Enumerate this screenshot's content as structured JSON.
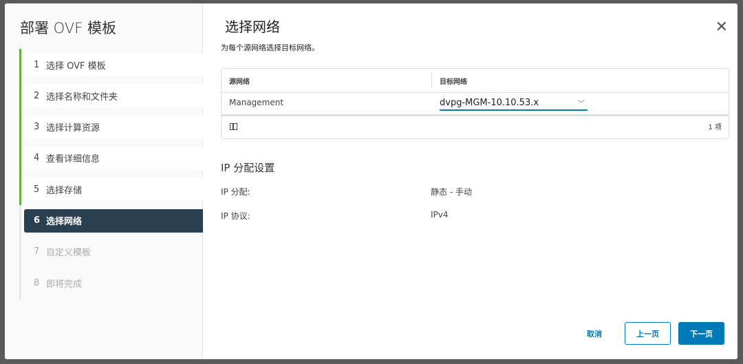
{
  "wizard": {
    "title": "部署 OVF 模板",
    "steps": [
      {
        "num": "1",
        "label": "选择 OVF 模板",
        "state": "complete"
      },
      {
        "num": "2",
        "label": "选择名称和文件夹",
        "state": "complete"
      },
      {
        "num": "3",
        "label": "选择计算资源",
        "state": "complete"
      },
      {
        "num": "4",
        "label": "查看详细信息",
        "state": "complete"
      },
      {
        "num": "5",
        "label": "选择存储",
        "state": "complete"
      },
      {
        "num": "6",
        "label": "选择网络",
        "state": "active"
      },
      {
        "num": "7",
        "label": "自定义模板",
        "state": "todo"
      },
      {
        "num": "8",
        "label": "即将完成",
        "state": "todo"
      }
    ]
  },
  "page": {
    "title": "选择网络",
    "close_icon": "close-icon",
    "description": "为每个源网络选择目标网络。"
  },
  "grid": {
    "headers": [
      "源网络",
      "目标网络"
    ],
    "rows": [
      {
        "source": "Management",
        "target": "dvpg-MGM-10.10.53.x"
      }
    ],
    "footer_count": "1 项",
    "columns_icon": "column-toggle-icon"
  },
  "ip": {
    "title": "IP 分配设置",
    "items": [
      {
        "label": "IP 分配:",
        "value": "静态 - 手动"
      },
      {
        "label": "IP 协议:",
        "value": "IPv4"
      }
    ]
  },
  "buttons": {
    "cancel": "取消",
    "back": "上一页",
    "next": "下一页"
  },
  "colors": {
    "accent": "#0079b8",
    "active_step": "#2a3f4f",
    "complete": "#62b33a"
  }
}
